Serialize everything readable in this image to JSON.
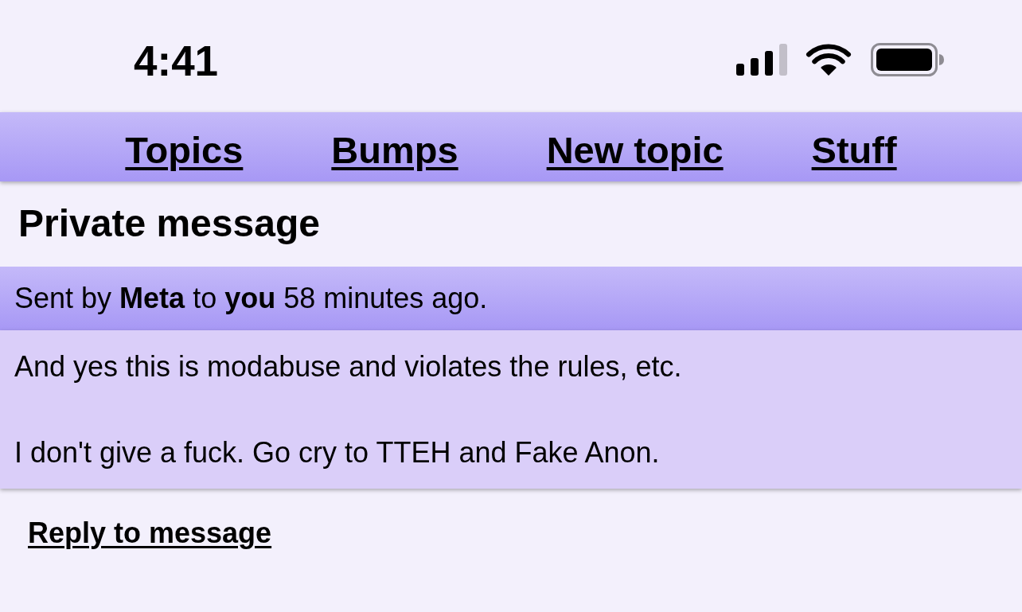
{
  "status_bar": {
    "time": "4:41"
  },
  "nav_links": [
    "Topics",
    "Bumps",
    "New topic",
    "Stuff"
  ],
  "page_title": "Private message",
  "message": {
    "header": "Sent by **Meta** to **you** 58 minutes ago.",
    "paragraphs": [
      "And yes this is modabuse and violates the rules, etc.",
      "I don't give a fuck. Go cry to TTEH and Fake Anon."
    ]
  },
  "reply_link": "Reply to message"
}
